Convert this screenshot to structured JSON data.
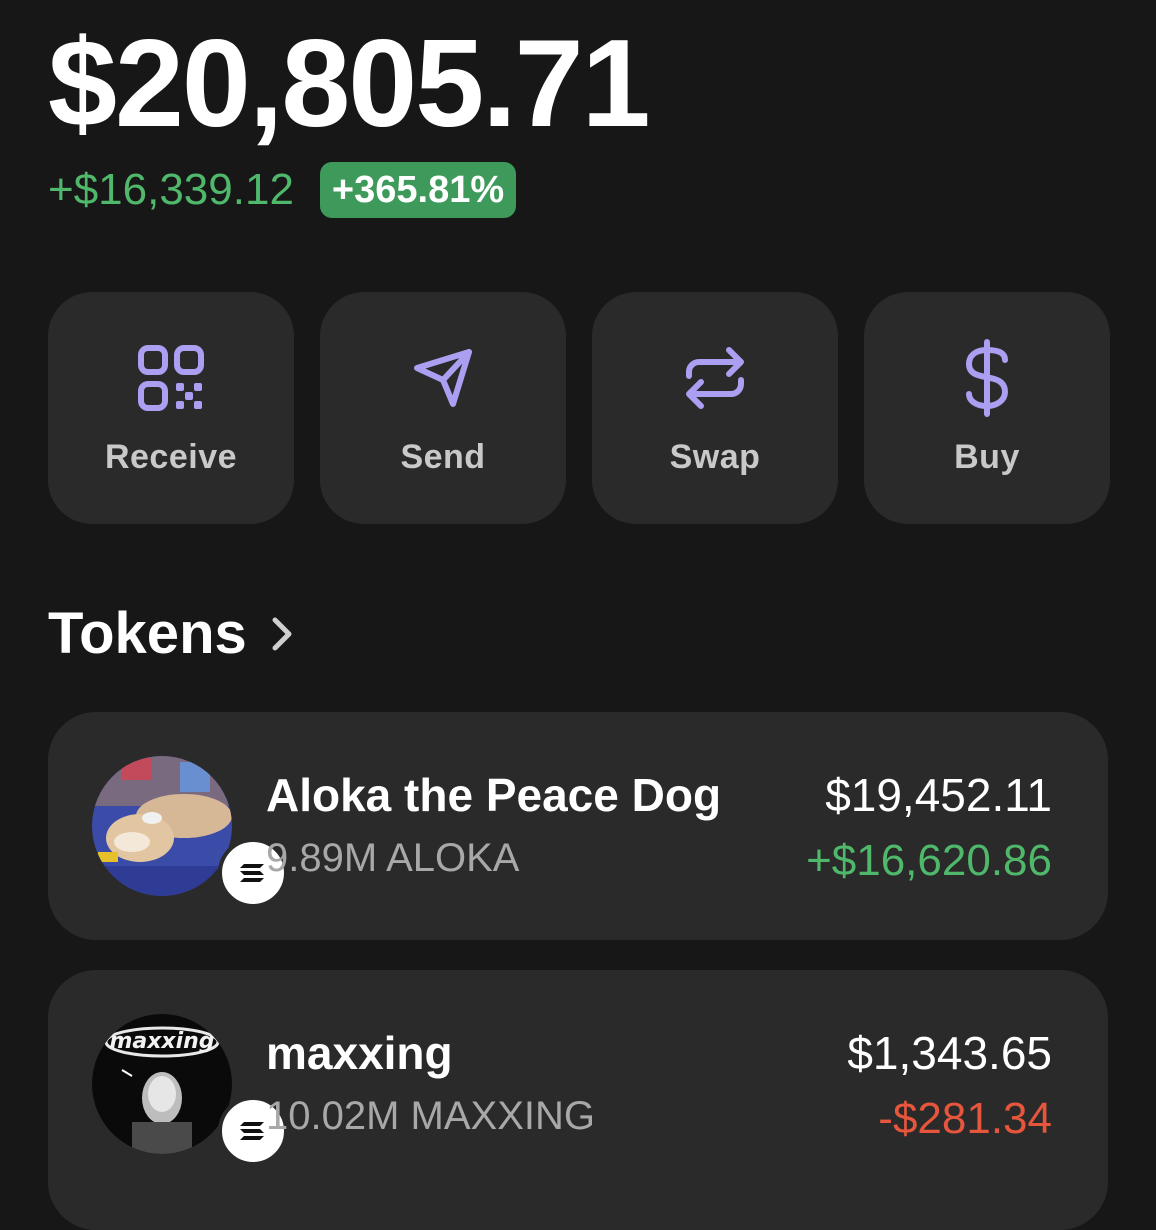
{
  "portfolio": {
    "balance": "$20,805.71",
    "change_amount": "+$16,339.12",
    "change_percent": "+365.81%"
  },
  "actions": [
    {
      "label": "Receive",
      "icon": "qr-code-icon"
    },
    {
      "label": "Send",
      "icon": "send-icon"
    },
    {
      "label": "Swap",
      "icon": "swap-icon"
    },
    {
      "label": "Buy",
      "icon": "dollar-icon"
    }
  ],
  "tokens_section": {
    "title": "Tokens"
  },
  "tokens": [
    {
      "name": "Aloka the Peace Dog",
      "amount": "9.89M ALOKA",
      "value": "$19,452.11",
      "pnl": "+$16,620.86",
      "pnl_direction": "positive",
      "avatar_icon": "dog-avatar-icon",
      "chain_icon": "solana-icon"
    },
    {
      "name": "maxxing",
      "amount": "10.02M MAXXING",
      "value": "$1,343.65",
      "pnl": "-$281.34",
      "pnl_direction": "negative",
      "avatar_icon": "maxxing-avatar-icon",
      "avatar_text": "maxxing",
      "chain_icon": "solana-icon"
    }
  ],
  "colors": {
    "background": "#171717",
    "card": "#2a2a2a",
    "accent_purple": "#ab9ff2",
    "positive": "#4fb86b",
    "negative": "#e5563c",
    "badge_green": "#3e9a5a"
  }
}
